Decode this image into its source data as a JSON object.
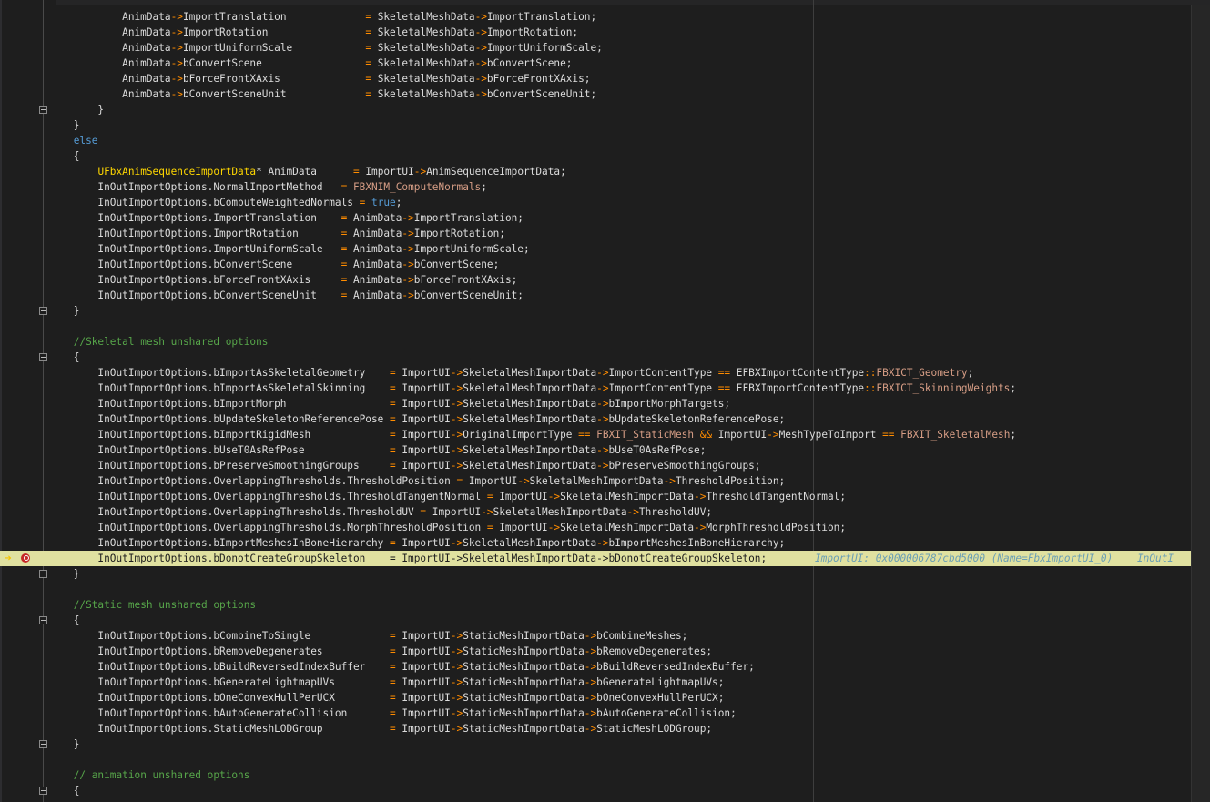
{
  "lines": [
    {
      "text": "            AnimData->ImportTranslation             = SkeletalMeshData->ImportTranslation;"
    },
    {
      "text": "            AnimData->ImportRotation                = SkeletalMeshData->ImportRotation;"
    },
    {
      "text": "            AnimData->ImportUniformScale            = SkeletalMeshData->ImportUniformScale;"
    },
    {
      "text": "            AnimData->bConvertScene                 = SkeletalMeshData->bConvertScene;"
    },
    {
      "text": "            AnimData->bForceFrontXAxis              = SkeletalMeshData->bForceFrontXAxis;"
    },
    {
      "text": "            AnimData->bConvertSceneUnit             = SkeletalMeshData->bConvertSceneUnit;"
    },
    {
      "text": "        }"
    },
    {
      "text": "    }"
    },
    {
      "text": "    else"
    },
    {
      "text": "    {"
    },
    {
      "text": "        UFbxAnimSequenceImportData* AnimData      = ImportUI->AnimSequenceImportData;"
    },
    {
      "text": "        InOutImportOptions.NormalImportMethod   = FBXNIM_ComputeNormals;"
    },
    {
      "text": "        InOutImportOptions.bComputeWeightedNormals = true;"
    },
    {
      "text": "        InOutImportOptions.ImportTranslation    = AnimData->ImportTranslation;"
    },
    {
      "text": "        InOutImportOptions.ImportRotation       = AnimData->ImportRotation;"
    },
    {
      "text": "        InOutImportOptions.ImportUniformScale   = AnimData->ImportUniformScale;"
    },
    {
      "text": "        InOutImportOptions.bConvertScene        = AnimData->bConvertScene;"
    },
    {
      "text": "        InOutImportOptions.bForceFrontXAxis     = AnimData->bForceFrontXAxis;"
    },
    {
      "text": "        InOutImportOptions.bConvertSceneUnit    = AnimData->bConvertSceneUnit;"
    },
    {
      "text": "    }"
    },
    {
      "text": ""
    },
    {
      "text": "    //Skeletal mesh unshared options"
    },
    {
      "text": "    {"
    },
    {
      "text": "        InOutImportOptions.bImportAsSkeletalGeometry    = ImportUI->SkeletalMeshImportData->ImportContentType == EFBXImportContentType::FBXICT_Geometry;"
    },
    {
      "text": "        InOutImportOptions.bImportAsSkeletalSkinning    = ImportUI->SkeletalMeshImportData->ImportContentType == EFBXImportContentType::FBXICT_SkinningWeights;"
    },
    {
      "text": "        InOutImportOptions.bImportMorph                 = ImportUI->SkeletalMeshImportData->bImportMorphTargets;"
    },
    {
      "text": "        InOutImportOptions.bUpdateSkeletonReferencePose = ImportUI->SkeletalMeshImportData->bUpdateSkeletonReferencePose;"
    },
    {
      "text": "        InOutImportOptions.bImportRigidMesh             = ImportUI->OriginalImportType == FBXIT_StaticMesh && ImportUI->MeshTypeToImport == FBXIT_SkeletalMesh;"
    },
    {
      "text": "        InOutImportOptions.bUseT0AsRefPose              = ImportUI->SkeletalMeshImportData->bUseT0AsRefPose;"
    },
    {
      "text": "        InOutImportOptions.bPreserveSmoothingGroups     = ImportUI->SkeletalMeshImportData->bPreserveSmoothingGroups;"
    },
    {
      "text": "        InOutImportOptions.OverlappingThresholds.ThresholdPosition = ImportUI->SkeletalMeshImportData->ThresholdPosition;"
    },
    {
      "text": "        InOutImportOptions.OverlappingThresholds.ThresholdTangentNormal = ImportUI->SkeletalMeshImportData->ThresholdTangentNormal;"
    },
    {
      "text": "        InOutImportOptions.OverlappingThresholds.ThresholdUV = ImportUI->SkeletalMeshImportData->ThresholdUV;"
    },
    {
      "text": "        InOutImportOptions.OverlappingThresholds.MorphThresholdPosition = ImportUI->SkeletalMeshImportData->MorphThresholdPosition;"
    },
    {
      "text": "        InOutImportOptions.bImportMeshesInBoneHierarchy = ImportUI->SkeletalMeshImportData->bImportMeshesInBoneHierarchy;"
    },
    {
      "text": "        InOutImportOptions.bDonotCreateGroupSkeleton    = ImportUI->SkeletalMeshImportData->bDonotCreateGroupSkeleton;",
      "current": true
    },
    {
      "text": "    }"
    },
    {
      "text": ""
    },
    {
      "text": "    //Static mesh unshared options"
    },
    {
      "text": "    {"
    },
    {
      "text": "        InOutImportOptions.bCombineToSingle             = ImportUI->StaticMeshImportData->bCombineMeshes;"
    },
    {
      "text": "        InOutImportOptions.bRemoveDegenerates           = ImportUI->StaticMeshImportData->bRemoveDegenerates;"
    },
    {
      "text": "        InOutImportOptions.bBuildReversedIndexBuffer    = ImportUI->StaticMeshImportData->bBuildReversedIndexBuffer;"
    },
    {
      "text": "        InOutImportOptions.bGenerateLightmapUVs         = ImportUI->StaticMeshImportData->bGenerateLightmapUVs;"
    },
    {
      "text": "        InOutImportOptions.bOneConvexHullPerUCX         = ImportUI->StaticMeshImportData->bOneConvexHullPerUCX;"
    },
    {
      "text": "        InOutImportOptions.bAutoGenerateCollision       = ImportUI->StaticMeshImportData->bAutoGenerateCollision;"
    },
    {
      "text": "        InOutImportOptions.StaticMeshLODGroup           = ImportUI->StaticMeshImportData->StaticMeshLODGroup;"
    },
    {
      "text": "    }"
    },
    {
      "text": ""
    },
    {
      "text": "    // animation unshared options"
    },
    {
      "text": "    {"
    }
  ],
  "inline_hint": "ImportUI: 0x000006787cbd5000 (Name=FbxImportUI_0)    InOutI",
  "colors": {
    "background": "#1e1e1e",
    "text": "#dcdcdc",
    "keyword": "#569cd6",
    "type": "#ffd700",
    "operator": "#ff8c00",
    "enum_value": "#d69d85",
    "comment": "#57a64a",
    "current_line": "#e0e1a0",
    "breakpoint": "#c62828",
    "exec_arrow": "#f5c400"
  },
  "icons": [
    "exec-arrow-icon",
    "breakpoint-icon",
    "fold-collapse-icon",
    "datatip-icon"
  ]
}
